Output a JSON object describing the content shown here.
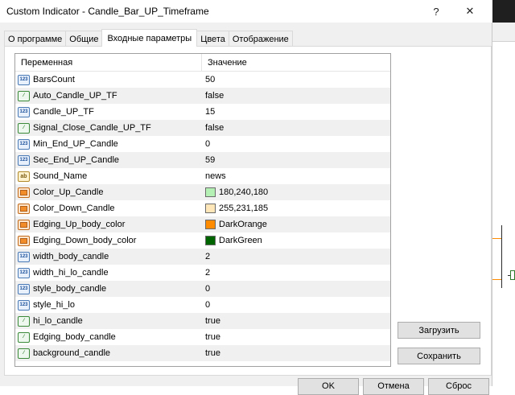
{
  "window": {
    "title": "Custom Indicator - Candle_Bar_UP_Timeframe",
    "help_label": "?",
    "close_label": "✕"
  },
  "tabs": [
    {
      "label": "О программе"
    },
    {
      "label": "Общие"
    },
    {
      "label": "Входные параметры"
    },
    {
      "label": "Цвета"
    },
    {
      "label": "Отображение"
    }
  ],
  "grid": {
    "col_variable": "Переменная",
    "col_value": "Значение",
    "rows": [
      {
        "icon": "123",
        "name": "BarsCount",
        "value": "50"
      },
      {
        "icon": "bool",
        "name": "Auto_Candle_UP_TF",
        "value": "false"
      },
      {
        "icon": "123",
        "name": "Candle_UP_TF",
        "value": "15"
      },
      {
        "icon": "bool",
        "name": "Signal_Close_Candle_UP_TF",
        "value": "false"
      },
      {
        "icon": "123",
        "name": "Min_End_UP_Candle",
        "value": "0"
      },
      {
        "icon": "123",
        "name": "Sec_End_UP_Candle",
        "value": "59"
      },
      {
        "icon": "ab",
        "name": "Sound_Name",
        "value": "news"
      },
      {
        "icon": "color",
        "name": "Color_Up_Candle",
        "value": "180,240,180",
        "swatch": "#b4f0b4"
      },
      {
        "icon": "color",
        "name": "Color_Down_Candle",
        "value": "255,231,185",
        "swatch": "#ffe7b9"
      },
      {
        "icon": "color",
        "name": "Edging_Up_body_color",
        "value": "DarkOrange",
        "swatch": "#ff8c00"
      },
      {
        "icon": "color",
        "name": "Edging_Down_body_color",
        "value": "DarkGreen",
        "swatch": "#006400"
      },
      {
        "icon": "123",
        "name": "width_body_candle",
        "value": "2"
      },
      {
        "icon": "123",
        "name": "width_hi_lo_candle",
        "value": "2"
      },
      {
        "icon": "123",
        "name": "style_body_candle",
        "value": "0"
      },
      {
        "icon": "123",
        "name": "style_hi_lo",
        "value": "0"
      },
      {
        "icon": "bool",
        "name": "hi_lo_candle",
        "value": "true"
      },
      {
        "icon": "bool",
        "name": "Edging_body_candle",
        "value": "true"
      },
      {
        "icon": "bool",
        "name": "background_candle",
        "value": "true"
      }
    ]
  },
  "buttons": {
    "load": "Загрузить",
    "save": "Сохранить",
    "ok": "OK",
    "cancel": "Отмена",
    "reset": "Сброс"
  }
}
